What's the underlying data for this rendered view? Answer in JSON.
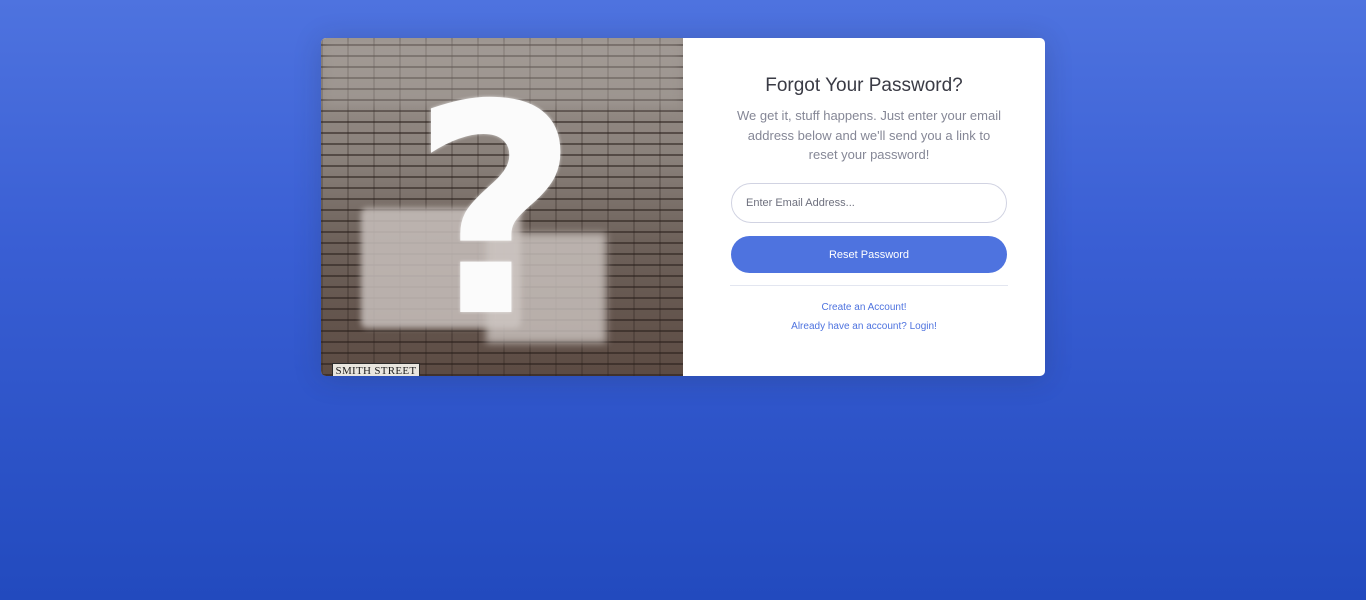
{
  "image_panel": {
    "street_sign": "SMITH STREET"
  },
  "form": {
    "title": "Forgot Your Password?",
    "subtitle": "We get it, stuff happens. Just enter your email address below and we'll send you a link to reset your password!",
    "email_placeholder": "Enter Email Address...",
    "email_value": "",
    "reset_button_label": "Reset Password"
  },
  "links": {
    "create_account": "Create an Account!",
    "login": "Already have an account? Login!"
  },
  "colors": {
    "primary": "#4e73df",
    "background_top": "#4e73df",
    "background_bottom": "#224abe",
    "heading_text": "#3a3b45",
    "muted_text": "#858796"
  }
}
